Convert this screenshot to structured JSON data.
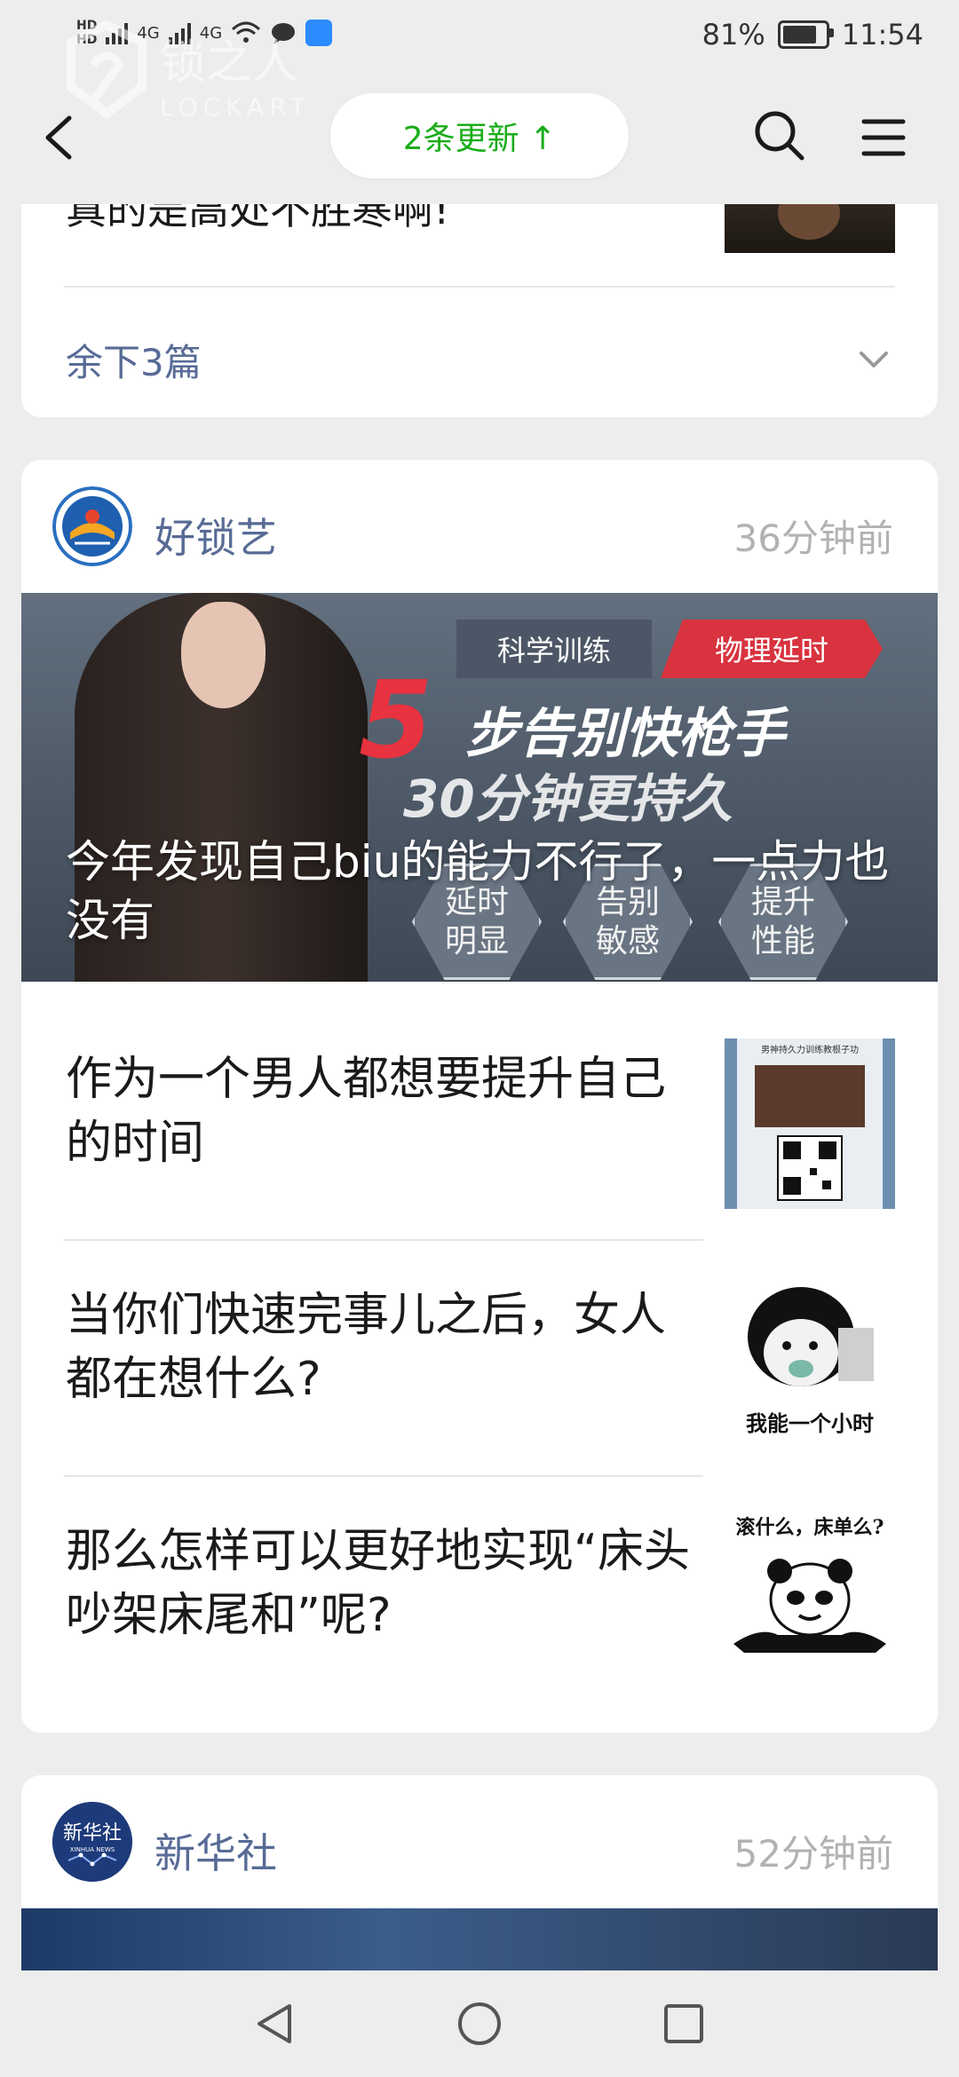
{
  "status_bar": {
    "left_labels": [
      "HD",
      "4G",
      "4G"
    ],
    "battery_percent": "81%",
    "battery_level": 0.81,
    "time": "11:54"
  },
  "watermark": {
    "brand": "锁之人",
    "brand_en": "LOCKART"
  },
  "navbar": {
    "back_icon": "back-chevron-icon",
    "update_pill": "2条更新 ↑",
    "search_icon": "search-icon",
    "menu_icon": "menu-icon"
  },
  "card_prev": {
    "partial_title": "真的是高处不胜寒啊!",
    "remaining_label": "余下3篇",
    "expand_icon": "chevron-down-icon"
  },
  "card_main": {
    "account_name": "好锁艺",
    "time_ago": "36分钟前",
    "hero": {
      "title": "今年发现自己biu的能力不行了，一点力也没有",
      "tag_left": "科学训练",
      "tag_right": "物理延时",
      "big_number": "5",
      "headline_1": "步告别快枪手",
      "headline_2": "30分钟更持久",
      "badges": [
        "延时\n明显",
        "告别\n敏感",
        "提升\n性能"
      ]
    },
    "articles": [
      {
        "title": "作为一个男人都想要提升自己的时间",
        "thumb_caption": "男神持久力训练教根子功"
      },
      {
        "title": "当你们快速完事儿之后，女人都在想什么?",
        "thumb_caption": "我能一个小时"
      },
      {
        "title": "那么怎样可以更好地实现“床头吵架床尾和”呢?",
        "thumb_caption": "滚什么，床单么?"
      }
    ]
  },
  "card_next": {
    "account_name": "新华社",
    "time_ago": "52分钟前",
    "avatar_text": "新华社",
    "avatar_text_en": "XINHUA NEWS"
  },
  "system_nav": {
    "back_icon": "nav-back-triangle-icon",
    "home_icon": "nav-home-circle-icon",
    "recents_icon": "nav-recents-square-icon"
  },
  "colors": {
    "accent_green": "#1aad19",
    "link_blue": "#576b95",
    "muted_gray": "#b2b2b2",
    "background": "#ededed"
  }
}
